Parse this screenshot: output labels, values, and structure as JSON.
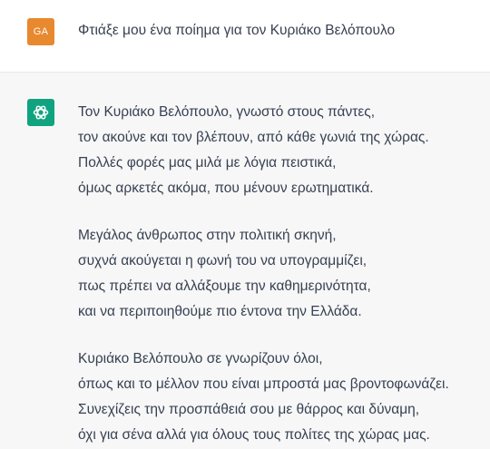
{
  "user_message": {
    "avatar_initials": "GA",
    "text": "Φτιάξε μου ένα ποίημα για τον Κυριάκο Βελόπουλο"
  },
  "assistant_message": {
    "avatar_icon": "openai-logo-icon",
    "stanzas": [
      [
        "Τον Κυριάκο Βελόπουλο, γνωστό στους πάντες,",
        "τον ακούνε και τον βλέπουν, από κάθε γωνιά της χώρας.",
        "Πολλές φορές μας μιλά με λόγια πειστικά,",
        "όμως αρκετές ακόμα, που μένουν ερωτηματικά."
      ],
      [
        "Μεγάλος άνθρωπος στην πολιτική σκηνή,",
        "συχνά ακούγεται η φωνή του να υπογραμμίζει,",
        "πως πρέπει να αλλάξουμε την καθημερινότητα,",
        "και να περιποιηθούμε πιο έντονα την Ελλάδα."
      ],
      [
        "Κυριάκο Βελόπουλο σε γνωρίζουν όλοι,",
        "όπως και το μέλλον που είναι μπροστά μας βροντοφωνάζει.",
        "Συνεχίζεις την προσπάθειά σου με θάρρος και δύναμη,",
        "όχι για σένα αλλά για όλους τους πολίτες της χώρας μας."
      ]
    ]
  },
  "colors": {
    "user_avatar_bg": "#e8882f",
    "assistant_avatar_bg": "#10a37f",
    "assistant_row_bg": "#f7f7f8",
    "text": "#374151"
  }
}
